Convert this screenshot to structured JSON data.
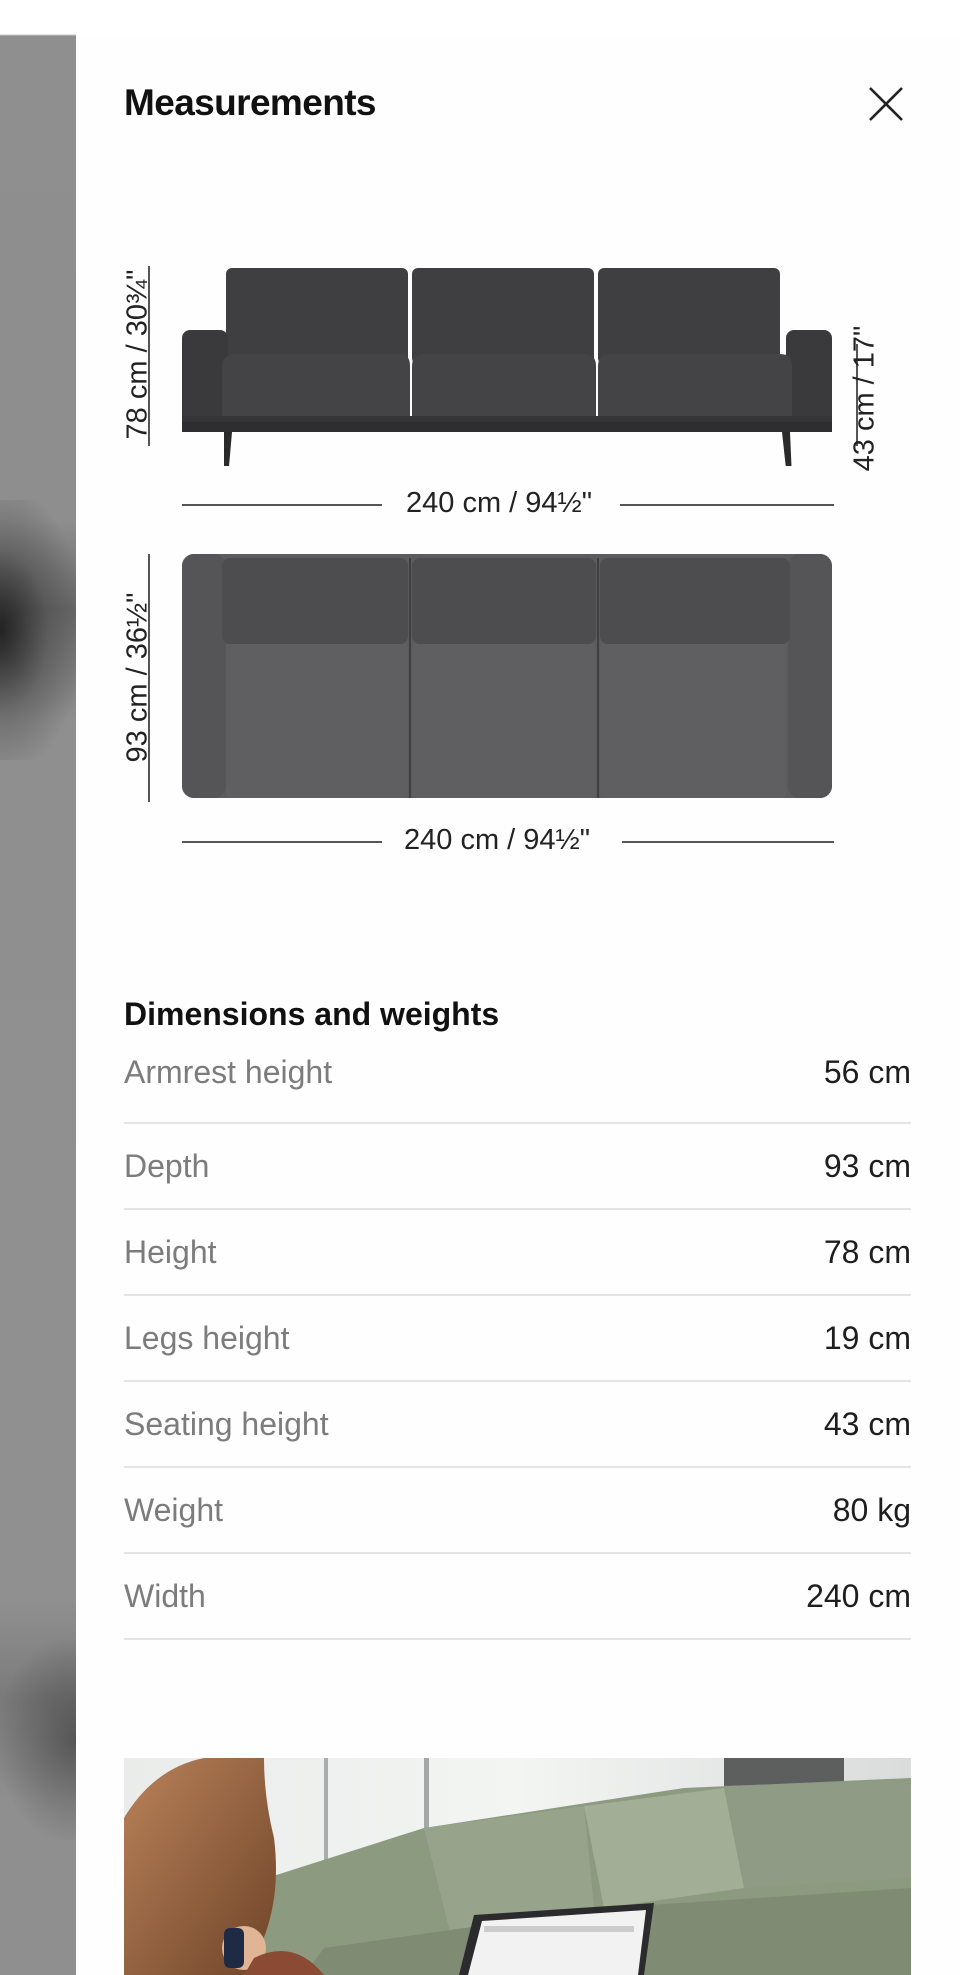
{
  "header": {
    "title": "Measurements",
    "close_icon": "close-icon"
  },
  "diagram": {
    "front_height_label": "78 cm / 30¾\"",
    "seat_height_label": "43 cm / 17\"",
    "front_width_label": "240 cm / 94½\"",
    "top_depth_label": "93 cm / 36½\"",
    "top_width_label": "240 cm / 94½\""
  },
  "dimensions": {
    "title": "Dimensions and weights",
    "rows": [
      {
        "label": "Armrest height",
        "value": "56 cm"
      },
      {
        "label": "Depth",
        "value": "93 cm"
      },
      {
        "label": "Height",
        "value": "78 cm"
      },
      {
        "label": "Legs height",
        "value": "19 cm"
      },
      {
        "label": "Seating height",
        "value": "43 cm"
      },
      {
        "label": "Weight",
        "value": "80 kg"
      },
      {
        "label": "Width",
        "value": "240 cm"
      }
    ]
  },
  "colors": {
    "sofa_front": "#3d3d3f",
    "sofa_top": "#5b5b5d",
    "divider": "#e4e4e4",
    "label_gray": "#7c7c7c"
  }
}
